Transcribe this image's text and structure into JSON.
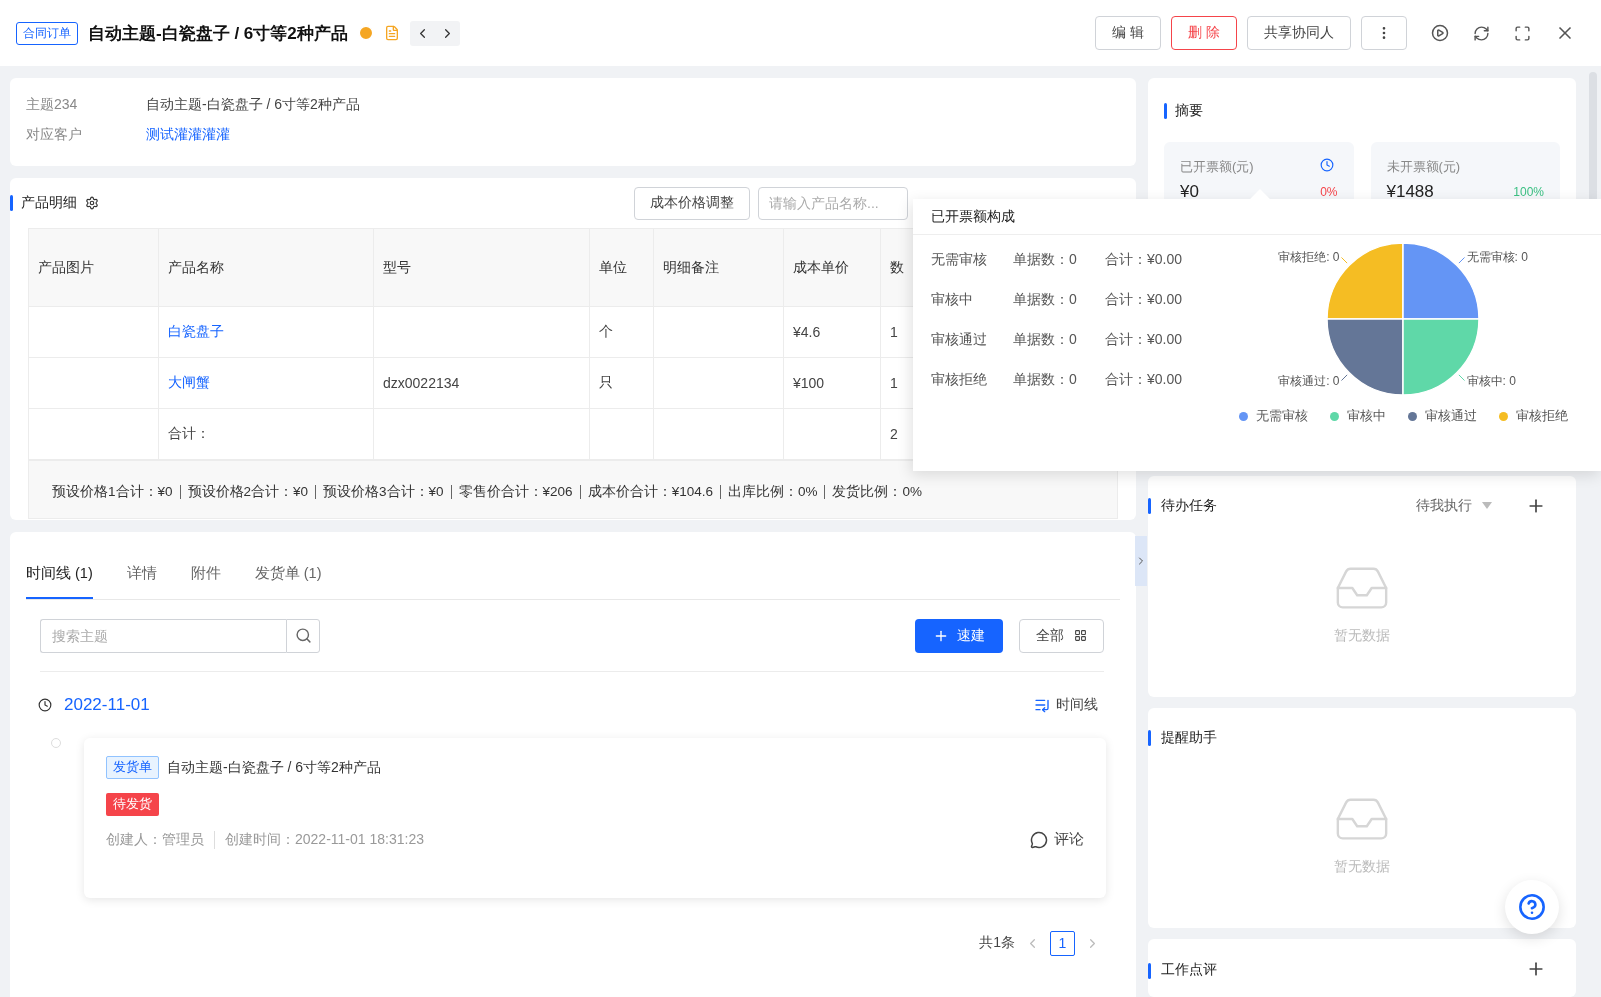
{
  "header": {
    "tag": "合同订单",
    "title": "自动主题-白瓷盘子 / 6寸等2种产品",
    "actions": [
      {
        "label": "编 辑",
        "kind": "default"
      },
      {
        "label": "删 除",
        "kind": "danger"
      },
      {
        "label": "共享协同人",
        "kind": "default"
      }
    ]
  },
  "info": [
    {
      "label": "主题234",
      "value": "自动主题-白瓷盘子 / 6寸等2种产品",
      "kind": "text"
    },
    {
      "label": "对应客户",
      "value": "测试灌灌灌灌",
      "kind": "link"
    }
  ],
  "products": {
    "title": "产品明细",
    "adjust_button": "成本价格调整",
    "search": {
      "placeholder": "请输入产品名称..."
    },
    "columns": [
      "产品图片",
      "产品名称",
      "型号",
      "单位",
      "明细备注",
      "成本单价",
      "数"
    ],
    "rows": [
      {
        "name": "白瓷盘子",
        "unit": "个",
        "cost": "¥4.6",
        "column_7": "1"
      },
      {
        "name": "大闸蟹",
        "model": "dzx0022134",
        "unit": "只",
        "cost": "¥100",
        "column_7": "1"
      }
    ],
    "total_row": {
      "label": "合计：",
      "column_7": "2"
    },
    "totals": [
      "预设价格1合计：¥0",
      "预设价格2合计：¥0",
      "预设价格3合计：¥0",
      "零售价合计：¥206",
      "成本价合计：¥104.6",
      "出库比例：0%",
      "发货比例：0%"
    ]
  },
  "timeline": {
    "tabs": [
      {
        "label": "时间线 (1)",
        "selected": true
      },
      {
        "label": "详情",
        "selected": false
      },
      {
        "label": "附件",
        "selected": false
      },
      {
        "label": "发货单 (1)",
        "selected": false
      }
    ],
    "search": {
      "placeholder": "搜索主题"
    },
    "quick_create": "速建",
    "filter": "全部",
    "date": "2022-11-01",
    "view": "时间线",
    "entries": [
      {
        "tag": "发货单",
        "title": "自动主题-白瓷盘子 / 6寸等2种产品",
        "status": "待发货",
        "creator": "创建人：管理员",
        "created": "创建时间：2022-11-01 18:31:23",
        "comment": "评论"
      }
    ],
    "pagination": {
      "total": "共1条",
      "pages": [
        {
          "label": "1",
          "selected": true
        }
      ]
    }
  },
  "summary": {
    "title": "摘要",
    "stats": [
      {
        "label": "已开票额(元)",
        "amount": "¥0",
        "percent": "0%",
        "color": "#f5444a",
        "history": true
      },
      {
        "label": "未开票额(元)",
        "amount": "¥1488",
        "percent": "100%",
        "color": "#3cc083",
        "history": false
      }
    ]
  },
  "popup": {
    "title": "已开票额构成",
    "rows": [
      {
        "status": "无需审核",
        "count": "单据数：0",
        "total": "合计：¥0.00"
      },
      {
        "status": "审核中",
        "count": "单据数：0",
        "total": "合计：¥0.00"
      },
      {
        "status": "审核通过",
        "count": "单据数：0",
        "total": "合计：¥0.00"
      },
      {
        "status": "审核拒绝",
        "count": "单据数：0",
        "total": "合计：¥0.00"
      }
    ],
    "legend": [
      {
        "label": "无需审核",
        "color": "#6495f5"
      },
      {
        "label": "审核中",
        "color": "#5fd8a8"
      },
      {
        "label": "审核通过",
        "color": "#647697"
      },
      {
        "label": "审核拒绝",
        "color": "#f5bd23"
      }
    ],
    "pie_labels": [
      {
        "text": "审核拒绝: 0",
        "color": "#f5bd23"
      },
      {
        "text": "无需审核: 0",
        "color": "#6495f5"
      },
      {
        "text": "审核通过: 0",
        "color": "#647697"
      },
      {
        "text": "审核中: 0",
        "color": "#5fd8a8"
      }
    ]
  },
  "todo": {
    "title": "待办任务",
    "filter": "待我执行",
    "empty": "暂无数据"
  },
  "reminder": {
    "title": "提醒助手",
    "empty": "暂无数据"
  },
  "review": {
    "title": "工作点评"
  }
}
